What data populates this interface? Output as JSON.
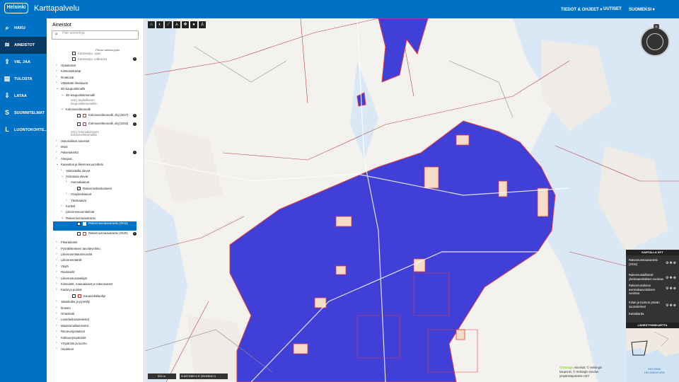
{
  "header": {
    "logo": "Helsinki",
    "title": "Karttapalvelu",
    "nav": [
      "TIEDOT & OHJEET ▾",
      "UUTISET",
      "SUOMEKSI ▾"
    ]
  },
  "sidebar": {
    "items": [
      {
        "label": "HAKU",
        "icon": "search-icon"
      },
      {
        "label": "AINEISTOT",
        "icon": "layers-icon"
      },
      {
        "label": "VIE, JAA",
        "icon": "share-icon"
      },
      {
        "label": "TULOSTA",
        "icon": "print-icon"
      },
      {
        "label": "LATAA",
        "icon": "download-icon"
      },
      {
        "label": "SUUNNITELMAT",
        "icon": "s-icon"
      },
      {
        "label": "LUONTOKOHTE...",
        "icon": "l-icon"
      }
    ]
  },
  "panel": {
    "title": "Aineistot",
    "search_placeholder": "Hae aineistoja",
    "collapse": "Piilota valikkorypäs",
    "rows": [
      {
        "t": "Karttasarja, opas",
        "ind": 1,
        "kind": "grey"
      },
      {
        "t": "Karttasarja, valkoinen",
        "ind": 1,
        "kind": "grey",
        "info": true
      },
      {
        "t": "Opaskartat",
        "ind": 0,
        "kind": "folder"
      },
      {
        "t": "Kiinteistökartat",
        "ind": 0,
        "kind": "folder"
      },
      {
        "t": "Ilmakuvat",
        "ind": 0,
        "kind": "folder"
      },
      {
        "t": "Vääräväri-ilmakuvat",
        "ind": 0,
        "kind": "folder"
      },
      {
        "t": "3D-kaupunkimallit",
        "ind": 0,
        "kind": "open"
      },
      {
        "t": "3D-kaupunkitietomalli",
        "ind": 1,
        "kind": "open"
      },
      {
        "t": "Siirry täydelliseen kaupunkitietomalliin",
        "ind": 2,
        "kind": "sub"
      },
      {
        "t": "Kolmioverkkomalli",
        "ind": 1,
        "kind": "open"
      },
      {
        "t": "Kolmioverkkomalli, obj (2017)",
        "ind": 2,
        "kind": "item",
        "info": true
      },
      {
        "t": "Kolmioverkkomalli, obj (2015)",
        "ind": 2,
        "kind": "item",
        "info": true
      },
      {
        "t": "Siirry fotorealistiseen kolmioverkkomalliin",
        "ind": 2,
        "kind": "sub"
      },
      {
        "t": "Historialliset aineistot",
        "ind": 0,
        "kind": "folder"
      },
      {
        "t": "Muut",
        "ind": 0,
        "kind": "folder"
      },
      {
        "t": "Palvelukartta",
        "ind": 0,
        "kind": "folder",
        "info": true
      },
      {
        "t": "Aluejaot",
        "ind": 0,
        "kind": "folder"
      },
      {
        "t": "Kaavoitus ja liikennesuunnittelu",
        "ind": 0,
        "kind": "open"
      },
      {
        "t": "Valmisteilla olevat",
        "ind": 1,
        "kind": "folder"
      },
      {
        "t": "Voimassa olevat",
        "ind": 1,
        "kind": "open"
      },
      {
        "t": "Asemakaavat",
        "ind": 2,
        "kind": "folder"
      },
      {
        "t": "Rakennuskieltoalueet",
        "ind": 2,
        "kind": "item"
      },
      {
        "t": "Osayleiskaavat",
        "ind": 2,
        "kind": "folder"
      },
      {
        "t": "Yleiskaavat",
        "ind": 2,
        "kind": "folder"
      },
      {
        "t": "Kortteli",
        "ind": 1,
        "kind": "folder"
      },
      {
        "t": "Liikennesuunnitelmat",
        "ind": 1,
        "kind": "folder"
      },
      {
        "t": "Rakennusmaavaranto",
        "ind": 1,
        "kind": "open"
      },
      {
        "t": "Rakennusmaavaranto (2016)",
        "ind": 2,
        "kind": "selected"
      },
      {
        "t": "Rakennusmaavaranto (2020)",
        "ind": 2,
        "kind": "item",
        "info": true
      },
      {
        "t": "Pikaraitiotiet",
        "ind": 0,
        "kind": "folder"
      },
      {
        "t": "Pyöräliikenteen tavoiteverkko",
        "ind": 0,
        "kind": "folder"
      },
      {
        "t": "Liikennemittausmuodot",
        "ind": 0,
        "kind": "folder"
      },
      {
        "t": "Liikennemäärät",
        "ind": 0,
        "kind": "folder"
      },
      {
        "t": "Väylä",
        "ind": 0,
        "kind": "folder"
      },
      {
        "t": "Rantareitit",
        "ind": 0,
        "kind": "folder"
      },
      {
        "t": "Liikenneturvatekijät",
        "ind": 0,
        "kind": "folder"
      },
      {
        "t": "Kiinteistöt, maanalaiset ja rakennukset",
        "ind": 0,
        "kind": "folder"
      },
      {
        "t": "Kadut ja puistot",
        "ind": 0,
        "kind": "folder"
      },
      {
        "t": "Kaupunkitilaohje",
        "ind": 1,
        "kind": "item"
      },
      {
        "t": "Jalankulku ja pyöräily",
        "ind": 0,
        "kind": "folder"
      },
      {
        "t": "Ilmasto",
        "ind": 0,
        "kind": "folder"
      },
      {
        "t": "OmaStadi",
        "ind": 0,
        "kind": "folder"
      },
      {
        "t": "Laserkeilausaineistot",
        "ind": 0,
        "kind": "folder"
      },
      {
        "t": "Maastomalliaineistot",
        "ind": 0,
        "kind": "folder"
      },
      {
        "t": "Rinnevarjostukset",
        "ind": 0,
        "kind": "folder"
      },
      {
        "t": "Kulttuuriympäristöt",
        "ind": 0,
        "kind": "folder"
      },
      {
        "t": "Ympäristö ja luonto",
        "ind": 0,
        "kind": "folder"
      },
      {
        "t": "Hankkeet",
        "ind": 0,
        "kind": "folder"
      }
    ]
  },
  "map": {
    "tools": [
      "home-icon",
      "contrast-icon",
      "ruler-icon",
      "measure-area-icon",
      "move-icon",
      "marker-icon",
      "person-icon"
    ],
    "compass_label": "N",
    "scale_label": "500 m",
    "coords": "N 6673380.0 E 25493040.0",
    "attribution": [
      "Aineistot: © Helsingin",
      "kaupunki, © Helsingin seudun",
      "ympäristöpalvelut HSY"
    ],
    "attribution_prefix": "©OSMaps",
    "legend_title": "KARTALLA NYT",
    "legend_items": [
      "Rakennusmaavaranto (2016)",
      "Rakennuslaillisesti yleiskaavoituksen vuokraa",
      "Rakennusoikeus asemakaavoituksen vuokraa",
      "Kiitan ja tuumun päivän suunnitelmat",
      "Kantakartta"
    ],
    "overview_title": "LÄHESTYMISKARTTA",
    "overview_label": [
      "HELSINKI",
      "HELSINGFORS"
    ],
    "colors": {
      "overlay": "#4040d8",
      "outline": "#e83a3a",
      "roads": "#ffffff",
      "water": "#d9e8f4"
    }
  }
}
